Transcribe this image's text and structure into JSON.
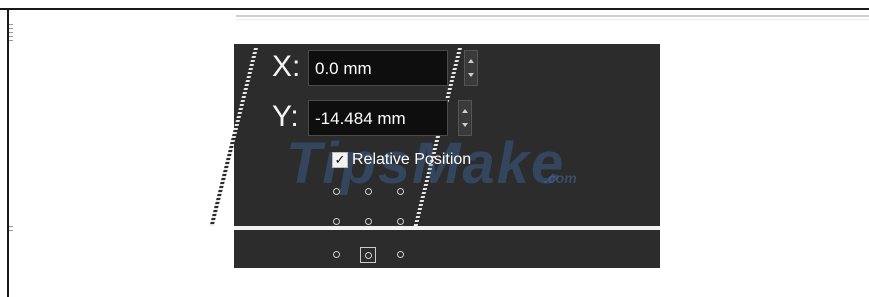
{
  "position_panel": {
    "x": {
      "label": "X:",
      "value": "0.0 mm"
    },
    "y": {
      "label": "Y:",
      "value": "-14.484 mm"
    },
    "relative_position": {
      "label": "Relative Position",
      "checked": true,
      "check_glyph": "✓"
    }
  },
  "anchor_grid": {
    "rows": 3,
    "columns": 3,
    "selected": "bottom-center"
  },
  "watermark": {
    "text": "TipsMake",
    "suffix": ".com"
  },
  "colors": {
    "panel_bg": "#2c2c2c",
    "field_bg": "#0e0e0e",
    "text": "#ffffff"
  }
}
